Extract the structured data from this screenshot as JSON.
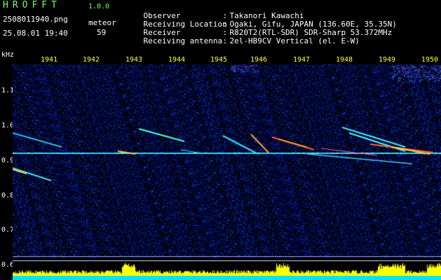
{
  "header": {
    "app_title": "HROFFT",
    "app_version": "1.0.0",
    "file_name": "2508011940.png",
    "datetime": "25.08.01 19:40",
    "meteor_label": "meteor",
    "meteor_count": "59"
  },
  "station_info": [
    {
      "key": "Observer",
      "value": "Takanori Kawachi"
    },
    {
      "key": "Receiving Location",
      "value": "Ogaki, Gifu, JAPAN (136.60E, 35.35N)"
    },
    {
      "key": "Receiver",
      "value": "R820T2(RTL-SDR) SDR-Sharp 53.372MHz"
    },
    {
      "key": "Receiving antenna",
      "value": "2el-HB9CV Vertical (el. E-W)"
    }
  ],
  "axis": {
    "y_unit": "kHz",
    "y_ticks": [
      "1.1",
      "1.0",
      "0.9",
      "0.8",
      "0.7",
      "0.6"
    ],
    "time_ticks": [
      "1941",
      "1942",
      "1943",
      "1944",
      "1945",
      "1946",
      "1947",
      "1948",
      "1949",
      "1950"
    ]
  },
  "colors": {
    "background": "#000000",
    "noise": "#08115a",
    "carrier": "#38c8ff",
    "echo_hot": "#ff5a28",
    "label_green": "#7cfc6a",
    "label_yellow": "#ffff3c",
    "amp_yellow": "#ffff00",
    "amp_cyan": "#00e5ff"
  }
}
